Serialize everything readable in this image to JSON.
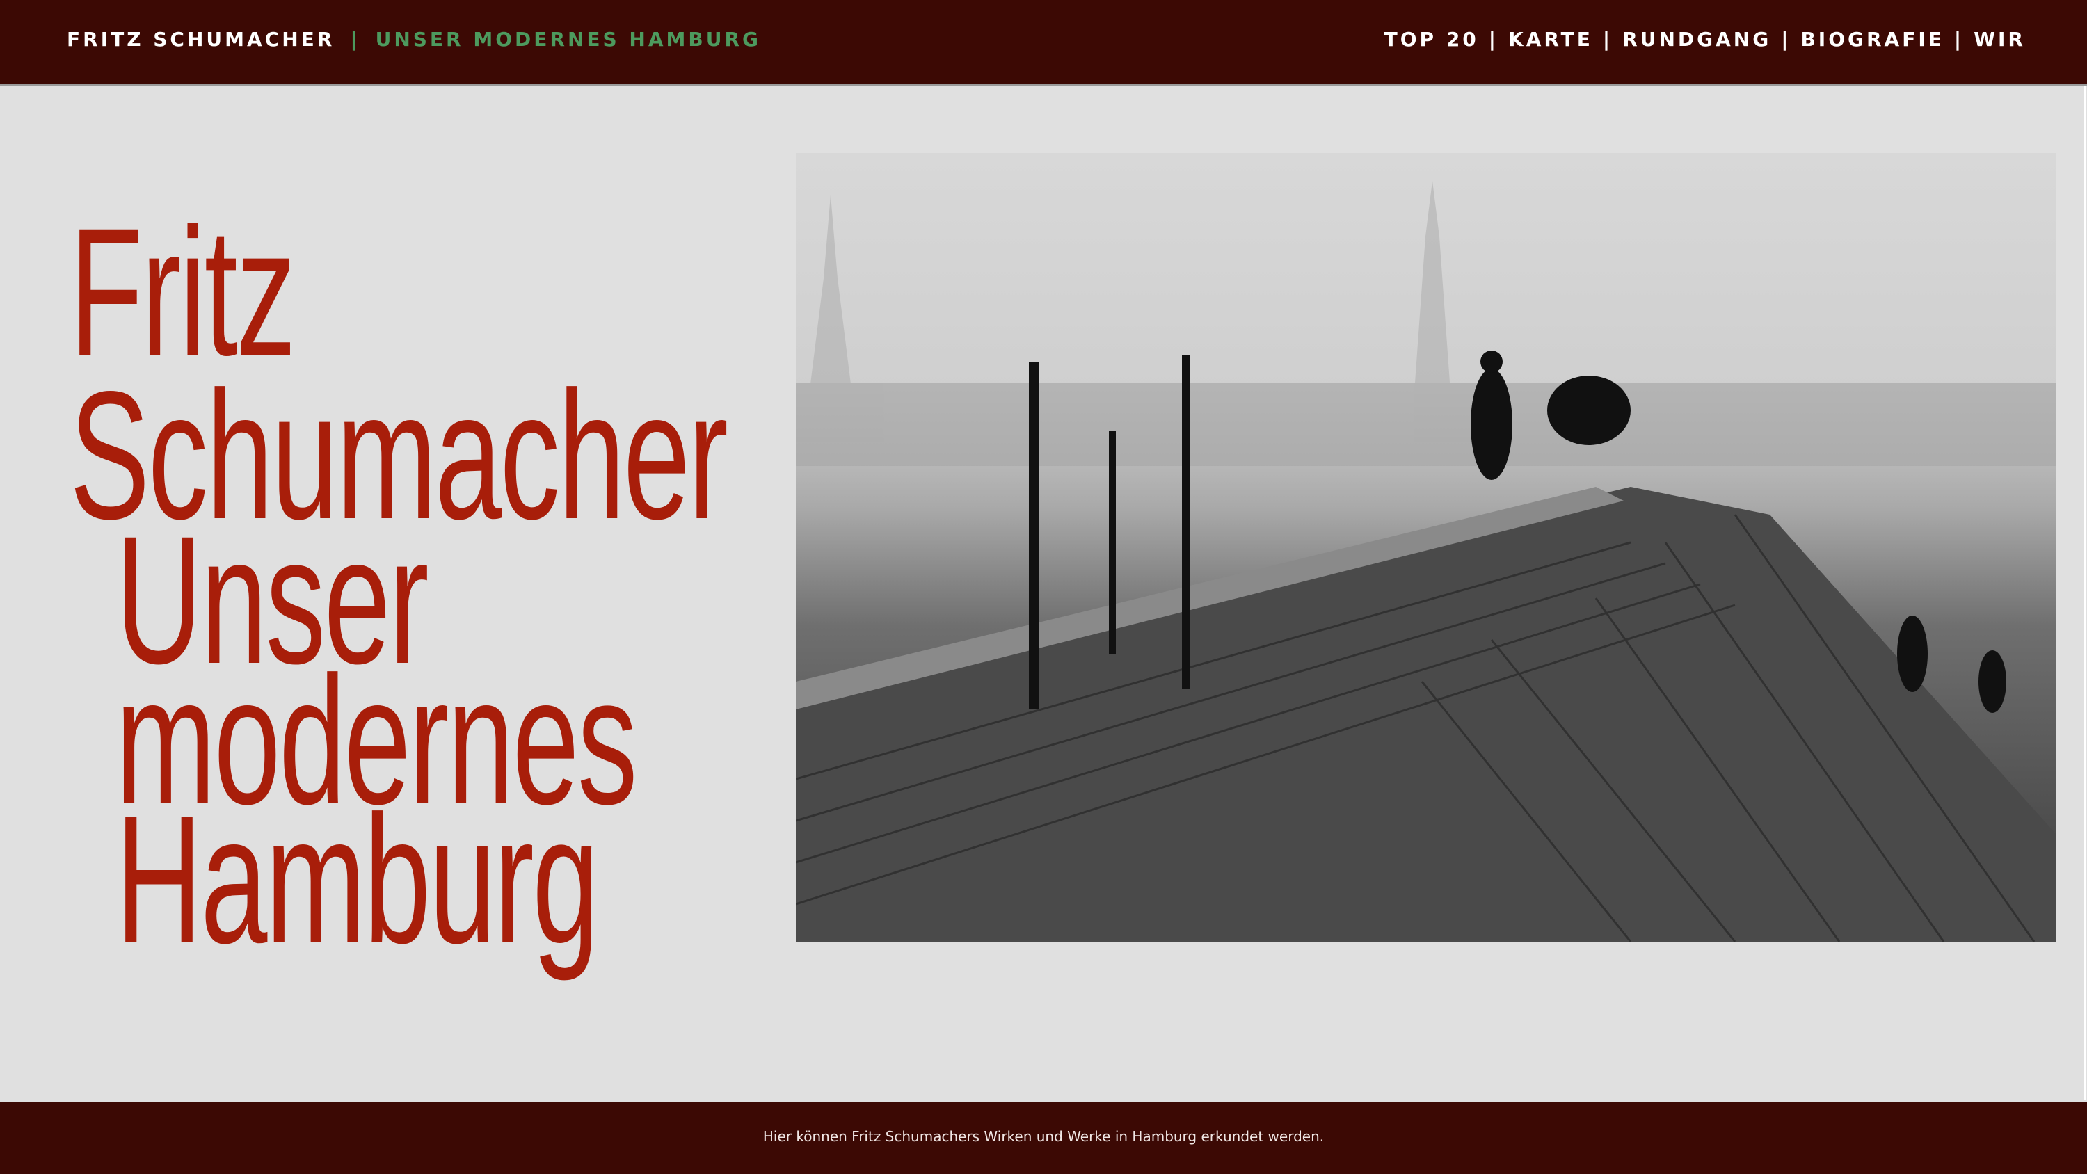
{
  "header": {
    "brand_title": "FRITZ SCHUMACHER",
    "brand_separator": "|",
    "brand_subtitle": "UNSER MODERNES HAMBURG",
    "nav": [
      {
        "label": "TOP 20"
      },
      {
        "label": "KARTE"
      },
      {
        "label": "RUNDGANG"
      },
      {
        "label": "BIOGRAFIE"
      },
      {
        "label": "WIR"
      }
    ],
    "nav_separator": "|"
  },
  "hero": {
    "title_lines": [
      "Fritz",
      "Schumacher"
    ],
    "subtitle_lines": [
      "Unser",
      "modernes",
      "Hamburg"
    ],
    "title_color": "#a81e0a"
  },
  "footer": {
    "text": "Hier können Fritz Schumachers Wirken und Werke in Hamburg erkundet werden."
  },
  "colors": {
    "header_bg": "#3c0904",
    "accent_green": "#4d9a5e",
    "page_bg": "#e0e0e0"
  }
}
